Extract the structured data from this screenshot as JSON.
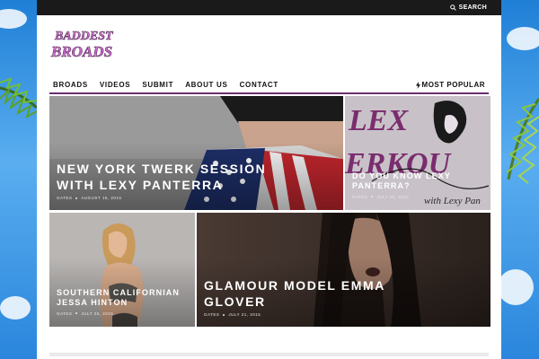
{
  "topbar": {
    "search_label": "SEARCH"
  },
  "brand": {
    "line1": "BADDEST",
    "line2": "BROADS"
  },
  "nav": {
    "items": [
      "BROADS",
      "VIDEOS",
      "SUBMIT",
      "ABOUT US",
      "CONTACT"
    ],
    "most_popular": "MOST POPULAR"
  },
  "posts": [
    {
      "title_line1": "NEW YORK TWERK SESSION",
      "title_line2": "WITH LEXY PANTERRA",
      "author": "GATES",
      "date": "AUGUST 16, 2015"
    },
    {
      "title_line1": "DO YOU KNOW LEXY",
      "title_line2": "PANTERRA?",
      "author": "GATES",
      "date": "JULY 25, 2015",
      "graphic_text": "LEX",
      "graphic_text2": "ERKOU",
      "graphic_text3": "with Lexy Pan"
    },
    {
      "title_line1": "SOUTHERN CALIFORNIAN",
      "title_line2": "JESSA HINTON",
      "author": "GATES",
      "date": "JULY 25, 2015"
    },
    {
      "title_line1": "GLAMOUR MODEL EMMA",
      "title_line2": "GLOVER",
      "author": "GATES",
      "date": "JULY 21, 2015"
    }
  ],
  "colors": {
    "accent": "#6b2f6f",
    "topbar": "#1a1a1a",
    "background_sky": "#2a86dc"
  }
}
